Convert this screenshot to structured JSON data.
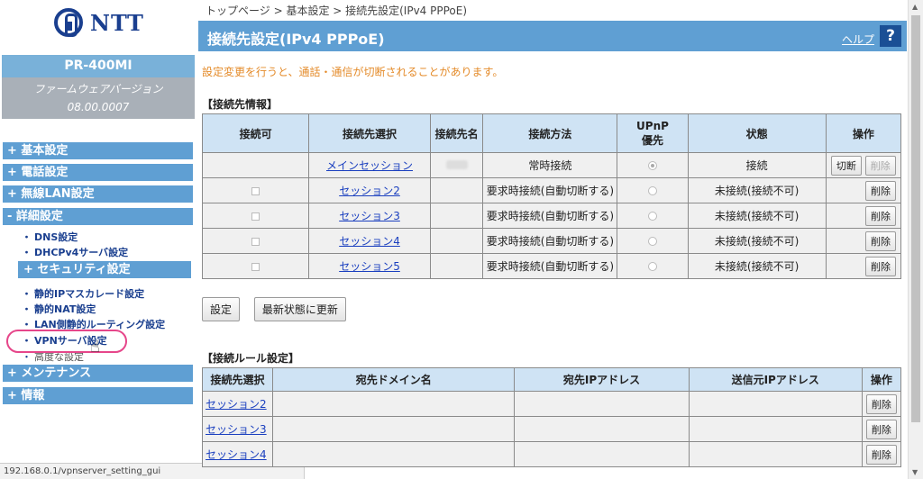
{
  "brand": {
    "logo_text": "NTT"
  },
  "device": {
    "model": "PR-400MI",
    "fw_label": "ファームウェアバージョン",
    "fw_version": "08.00.0007"
  },
  "sidebar": {
    "basic": "+ 基本設定",
    "phone": "+ 電話設定",
    "wlan": "+ 無線LAN設定",
    "detail": "- 詳細設定",
    "dns": "DNS設定",
    "dhcp": "DHCPv4サーバ設定",
    "security": "+ セキュリティ設定",
    "ipmasq": "静的IPマスカレード設定",
    "nat": "静的NAT設定",
    "lanroute": "LAN側静的ルーティング設定",
    "vpn": "VPNサーバ設定",
    "advanced": "高度な設定",
    "maint": "+ メンテナンス",
    "info": "+ 情報"
  },
  "status_bar": "192.168.0.1/vpnserver_setting_gui",
  "breadcrumb": "トップページ > 基本設定 > 接続先設定(IPv4 PPPoE)",
  "page_title": "接続先設定(IPv4 PPPoE)",
  "help_label": "ヘルプ",
  "help_icon": "?",
  "warning": "設定変更を行うと、通話・通信が切断されることがあります。",
  "connection": {
    "section_title": "【接続先情報】",
    "headers": {
      "enable": "接続可",
      "select": "接続先選択",
      "name": "接続先名",
      "method": "接続方法",
      "upnp1": "UPnP",
      "upnp2": "優先",
      "status": "状態",
      "ops": "操作"
    },
    "rows": [
      {
        "select": "メインセッション",
        "method": "常時接続",
        "status": "接続",
        "op1": "切断",
        "op2": "削除"
      },
      {
        "select": "セッション2",
        "method": "要求時接続(自動切断する)",
        "status": "未接続(接続不可)",
        "op2": "削除"
      },
      {
        "select": "セッション3",
        "method": "要求時接続(自動切断する)",
        "status": "未接続(接続不可)",
        "op2": "削除"
      },
      {
        "select": "セッション4",
        "method": "要求時接続(自動切断する)",
        "status": "未接続(接続不可)",
        "op2": "削除"
      },
      {
        "select": "セッション5",
        "method": "要求時接続(自動切断する)",
        "status": "未接続(接続不可)",
        "op2": "削除"
      }
    ]
  },
  "buttons": {
    "apply": "設定",
    "refresh": "最新状態に更新"
  },
  "rules": {
    "section_title": "【接続ルール設定】",
    "headers": {
      "select": "接続先選択",
      "domain": "宛先ドメイン名",
      "dst_ip": "宛先IPアドレス",
      "src_ip": "送信元IPアドレス",
      "ops": "操作"
    },
    "rows": [
      {
        "select": "セッション2",
        "op": "削除"
      },
      {
        "select": "セッション3",
        "op": "削除"
      },
      {
        "select": "セッション4",
        "op": "削除"
      }
    ]
  }
}
